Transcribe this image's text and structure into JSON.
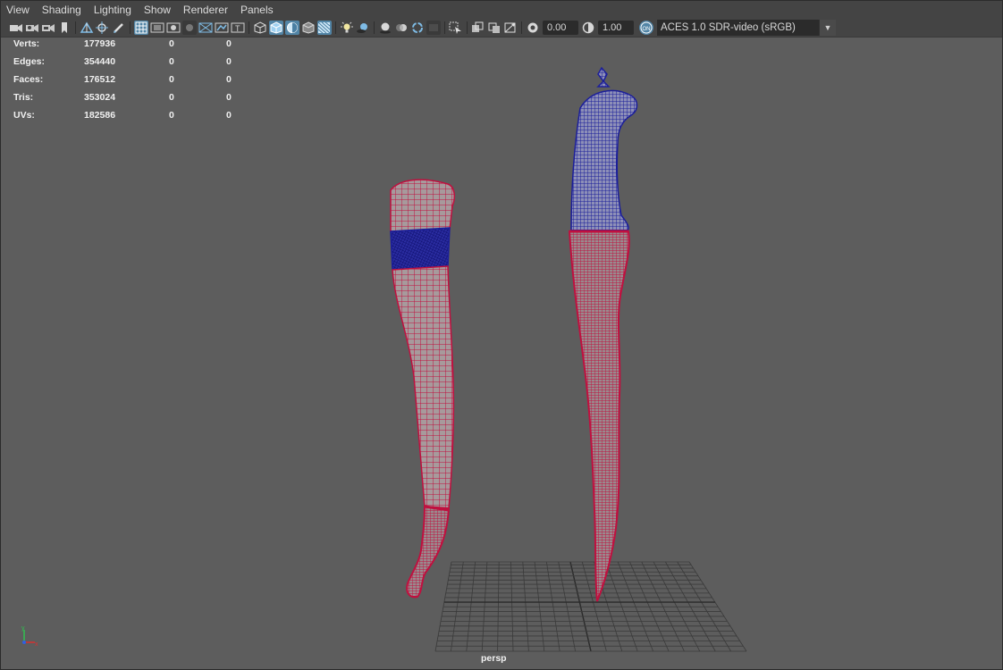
{
  "menu": [
    "View",
    "Shading",
    "Lighting",
    "Show",
    "Renderer",
    "Panels"
  ],
  "toolbar": {
    "icons": [
      "select-camera-icon",
      "camera-attributes-icon",
      "bookmark-camera-icon",
      "bookmark-icon",
      "image-plane-icon",
      "2d-pan-zoom-icon",
      "grease-pencil-icon",
      "grid-icon",
      "film-gate-icon",
      "resolution-gate-icon",
      "gate-mask-icon",
      "field-chart-icon",
      "safe-action-icon",
      "safe-title-icon",
      "wireframe-icon",
      "smooth-shade-icon",
      "wireframe-on-shaded-icon",
      "xray-icon",
      "xray-joints-icon",
      "use-all-lights-icon",
      "shadows-icon",
      "screen-space-ao-icon",
      "motion-blur-icon",
      "multisample-aa-icon",
      "depth-of-field-icon",
      "isolate-select-icon",
      "xray-component-icon",
      "two-sided-lighting-icon",
      "backface-culling-icon",
      "exposure-icon",
      "gamma-icon",
      "color-management-icon"
    ],
    "exposure_value": "0.00",
    "gamma_value": "1.00",
    "color_space": "ACES 1.0 SDR-video (sRGB)"
  },
  "hud": {
    "rows": [
      {
        "label": "Verts:",
        "v1": "177936",
        "v2": "0",
        "v3": "0"
      },
      {
        "label": "Edges:",
        "v1": "354440",
        "v2": "0",
        "v3": "0"
      },
      {
        "label": "Faces:",
        "v1": "176512",
        "v2": "0",
        "v3": "0"
      },
      {
        "label": "Tris:",
        "v1": "353024",
        "v2": "0",
        "v3": "0"
      },
      {
        "label": "UVs:",
        "v1": "182586",
        "v2": "0",
        "v3": "0"
      }
    ]
  },
  "viewport": {
    "camera": "persp",
    "colors": {
      "background": "#5d5d5d",
      "mesh_red": "#c0103f",
      "mesh_blue": "#1c1f9a",
      "mesh_fill": "#a79a9c",
      "grid": "#3a3a3a",
      "axis_x": "#d83030",
      "axis_y": "#30c050",
      "axis_z": "#3060e0"
    }
  }
}
